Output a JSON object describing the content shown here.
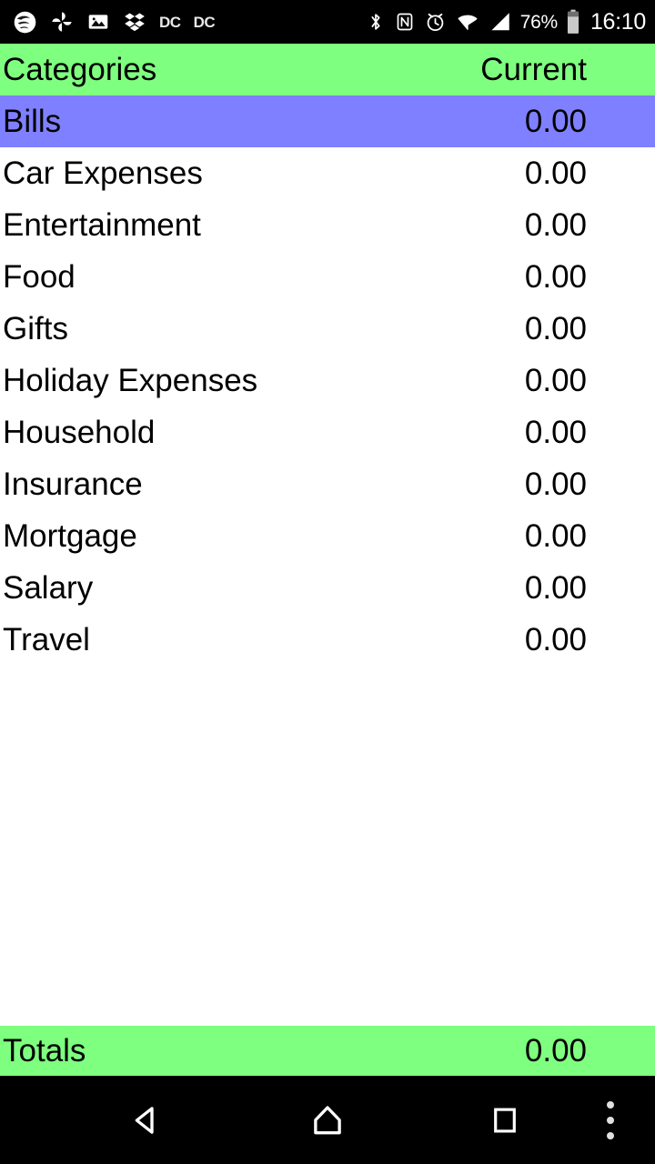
{
  "status_bar": {
    "notification_icons": [
      {
        "name": "swirl-logo-icon",
        "label": ""
      },
      {
        "name": "pinwheel-icon",
        "label": ""
      },
      {
        "name": "photo-image-icon",
        "label": ""
      },
      {
        "name": "dropbox-icon",
        "label": ""
      },
      {
        "name": "dc-app-icon",
        "label": "DC"
      },
      {
        "name": "dc-app-icon-2",
        "label": "DC"
      }
    ],
    "system_icons": [
      {
        "name": "bluetooth-icon"
      },
      {
        "name": "nfc-icon"
      },
      {
        "name": "alarm-clock-icon"
      },
      {
        "name": "wifi-icon"
      },
      {
        "name": "cellular-signal-icon"
      }
    ],
    "battery_percent": "76%",
    "clock": "16:10"
  },
  "header": {
    "category_column": "Categories",
    "value_column": "Current"
  },
  "rows": [
    {
      "label": "Bills",
      "value": "0.00",
      "selected": true
    },
    {
      "label": "Car Expenses",
      "value": "0.00",
      "selected": false
    },
    {
      "label": "Entertainment",
      "value": "0.00",
      "selected": false
    },
    {
      "label": "Food",
      "value": "0.00",
      "selected": false
    },
    {
      "label": "Gifts",
      "value": "0.00",
      "selected": false
    },
    {
      "label": "Holiday Expenses",
      "value": "0.00",
      "selected": false
    },
    {
      "label": "Household",
      "value": "0.00",
      "selected": false
    },
    {
      "label": "Insurance",
      "value": "0.00",
      "selected": false
    },
    {
      "label": "Mortgage",
      "value": "0.00",
      "selected": false
    },
    {
      "label": "Salary",
      "value": "0.00",
      "selected": false
    },
    {
      "label": "Travel",
      "value": "0.00",
      "selected": false
    }
  ],
  "totals": {
    "label": "Totals",
    "value": "0.00"
  },
  "nav_bar": {
    "back": "back-icon",
    "home": "home-icon",
    "recents": "recents-icon",
    "overflow": "overflow-menu-icon"
  },
  "colors": {
    "header_green": "#7fff7f",
    "selection_blue": "#7f80ff",
    "background": "#ffffff",
    "system_black": "#000000",
    "text": "#000000"
  }
}
